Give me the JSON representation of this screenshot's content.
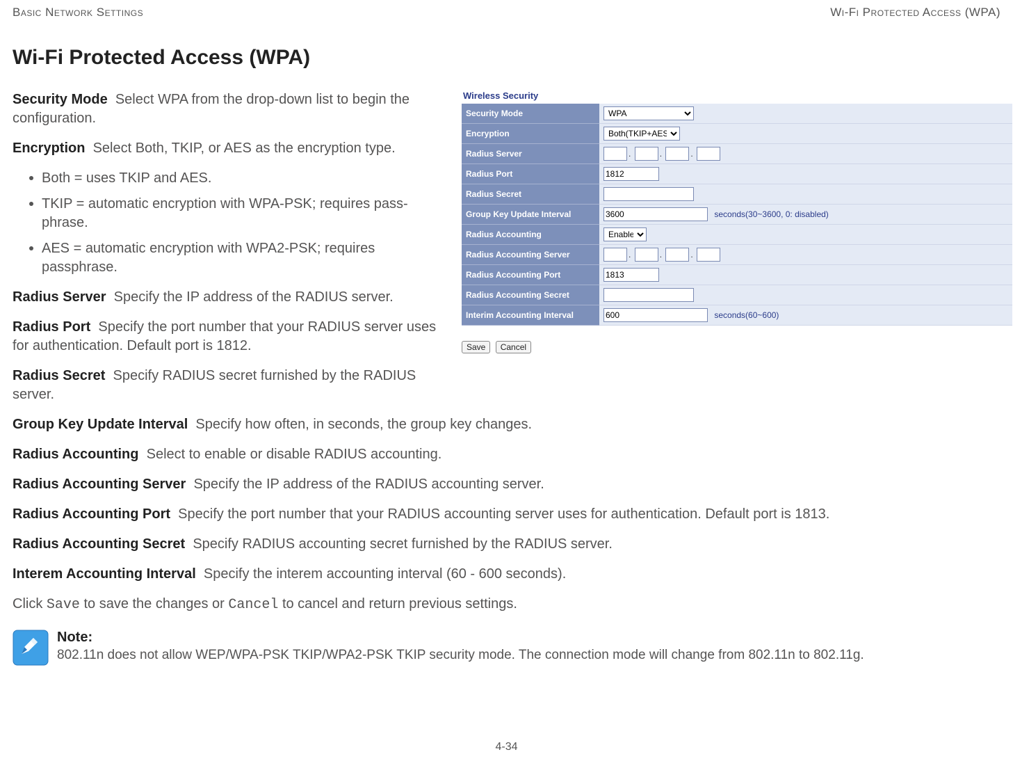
{
  "header": {
    "left": "Basic Network Settings",
    "right": "Wi-Fi Protected Access (WPA)"
  },
  "page_title": "Wi-Fi Protected Access (WPA)",
  "defs": {
    "security_mode": {
      "term": "Security Mode",
      "desc": "Select WPA from the drop-down list to begin the configuration."
    },
    "encryption": {
      "term": "Encryption",
      "desc": "Select Both, TKIP, or AES as the encryption type."
    },
    "enc_bullets": [
      "Both = uses TKIP and AES.",
      "TKIP = automatic encryption with WPA-PSK; requires pass-phrase.",
      "AES = automatic encryption with WPA2-PSK; requires passphrase."
    ],
    "radius_server": {
      "term": "Radius Server",
      "desc": "Specify the IP address of the RADIUS server."
    },
    "radius_port": {
      "term": "Radius Port",
      "desc": "Specify the port number that your RADIUS server uses for authentication. Default port is 1812."
    },
    "radius_secret": {
      "term": "Radius Secret",
      "desc": "Specify RADIUS secret furnished by the RADIUS server."
    },
    "group_key": {
      "term": "Group Key Update Interval",
      "desc": "Specify how often, in seconds, the group key changes."
    },
    "radius_acct": {
      "term": "Radius Accounting",
      "desc": "Select to enable or disable RADIUS accounting."
    },
    "radius_acct_server": {
      "term": "Radius Accounting Server",
      "desc": "Specify the IP address of the RADIUS accounting server."
    },
    "radius_acct_port": {
      "term": "Radius Accounting Port",
      "desc": "Specify the port number that your RADIUS accounting server uses for authentication. Default port is 1813."
    },
    "radius_acct_secret": {
      "term": "Radius Accounting Secret",
      "desc": "Specify RADIUS accounting secret furnished by the RADIUS server."
    },
    "interim": {
      "term": "Interem Accounting Interval",
      "desc": "Specify the interem accounting interval (60 - 600 seconds)."
    }
  },
  "closing_pre": "Click ",
  "closing_save": "Save",
  "closing_mid": " to save the changes or ",
  "closing_cancel": "Cancel",
  "closing_post": " to cancel and return previous settings.",
  "panel": {
    "title": "Wireless Security",
    "rows": {
      "security_mode": {
        "label": "Security Mode",
        "value": "WPA"
      },
      "encryption": {
        "label": "Encryption",
        "value": "Both(TKIP+AES)"
      },
      "radius_server": {
        "label": "Radius Server"
      },
      "radius_port": {
        "label": "Radius Port",
        "value": "1812"
      },
      "radius_secret": {
        "label": "Radius Secret"
      },
      "group_key": {
        "label": "Group Key Update Interval",
        "value": "3600",
        "hint": "seconds(30~3600, 0: disabled)"
      },
      "radius_acct": {
        "label": "Radius Accounting",
        "value": "Enable"
      },
      "radius_acct_server": {
        "label": "Radius Accounting Server"
      },
      "radius_acct_port": {
        "label": "Radius Accounting Port",
        "value": "1813"
      },
      "radius_acct_secret": {
        "label": "Radius Accounting Secret"
      },
      "interim": {
        "label": "Interim Accounting Interval",
        "value": "600",
        "hint": "seconds(60~600)"
      }
    },
    "buttons": {
      "save": "Save",
      "cancel": "Cancel"
    }
  },
  "note": {
    "title": "Note:",
    "text": "802.11n does not allow WEP/WPA-PSK TKIP/WPA2-PSK TKIP security mode. The connection mode will change from 802.11n to 802.11g."
  },
  "page_number": "4-34"
}
